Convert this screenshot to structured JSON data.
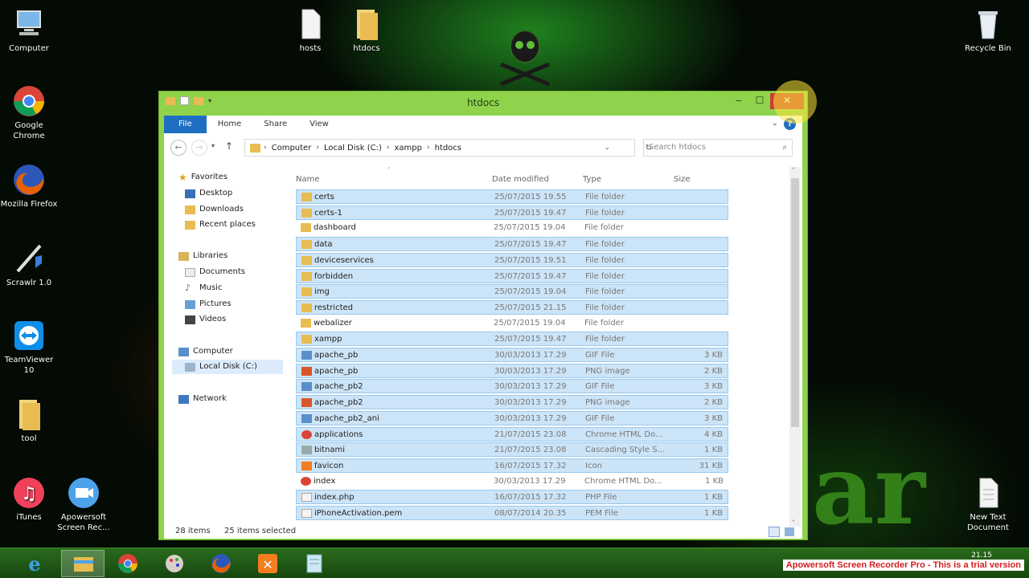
{
  "desktop": {
    "icons": [
      {
        "id": "computer",
        "label": "Computer"
      },
      {
        "id": "hosts",
        "label": "hosts"
      },
      {
        "id": "htdocs",
        "label": "htdocs"
      },
      {
        "id": "recycle",
        "label": "Recycle Bin"
      },
      {
        "id": "chrome",
        "label": "Google Chrome"
      },
      {
        "id": "firefox",
        "label": "Mozilla Firefox"
      },
      {
        "id": "scrawlr",
        "label": "Scrawlr 1.0"
      },
      {
        "id": "teamviewer",
        "label": "TeamViewer 10"
      },
      {
        "id": "tool",
        "label": "tool"
      },
      {
        "id": "itunes",
        "label": "iTunes"
      },
      {
        "id": "apowersoft",
        "label": "Apowersoft Screen Rec..."
      },
      {
        "id": "newtext",
        "label": "New Text Document"
      }
    ],
    "wallpaper_text": "ar"
  },
  "window": {
    "title": "htdocs",
    "minimize": "‒",
    "maximize": "☐",
    "close": "✕",
    "ribbon_tabs": [
      "File",
      "Home",
      "Share",
      "View"
    ],
    "help": "?",
    "address": {
      "crumbs": [
        "Computer",
        "Local Disk (C:)",
        "xampp",
        "htdocs"
      ]
    },
    "search": {
      "placeholder": "Search htdocs"
    },
    "nav": {
      "favorites": "Favorites",
      "desktop": "Desktop",
      "downloads": "Downloads",
      "recent": "Recent places",
      "libraries": "Libraries",
      "documents": "Documents",
      "music": "Music",
      "pictures": "Pictures",
      "videos": "Videos",
      "computer": "Computer",
      "localdisk": "Local Disk (C:)",
      "network": "Network"
    },
    "columns": {
      "name": "Name",
      "date": "Date modified",
      "type": "Type",
      "size": "Size"
    },
    "files": [
      {
        "name": "certs",
        "date": "25/07/2015 19.55",
        "type": "File folder",
        "size": "",
        "icon": "folder",
        "selected": true
      },
      {
        "name": "certs-1",
        "date": "25/07/2015 19.47",
        "type": "File folder",
        "size": "",
        "icon": "folder",
        "selected": true
      },
      {
        "name": "dashboard",
        "date": "25/07/2015 19.04",
        "type": "File folder",
        "size": "",
        "icon": "folder",
        "selected": false
      },
      {
        "name": "data",
        "date": "25/07/2015 19.47",
        "type": "File folder",
        "size": "",
        "icon": "folder",
        "selected": true
      },
      {
        "name": "deviceservices",
        "date": "25/07/2015 19.51",
        "type": "File folder",
        "size": "",
        "icon": "folder",
        "selected": true
      },
      {
        "name": "forbidden",
        "date": "25/07/2015 19.47",
        "type": "File folder",
        "size": "",
        "icon": "folder",
        "selected": true
      },
      {
        "name": "img",
        "date": "25/07/2015 19.04",
        "type": "File folder",
        "size": "",
        "icon": "folder",
        "selected": true
      },
      {
        "name": "restricted",
        "date": "25/07/2015 21.15",
        "type": "File folder",
        "size": "",
        "icon": "folder",
        "selected": true
      },
      {
        "name": "webalizer",
        "date": "25/07/2015 19.04",
        "type": "File folder",
        "size": "",
        "icon": "folder",
        "selected": false
      },
      {
        "name": "xampp",
        "date": "25/07/2015 19.47",
        "type": "File folder",
        "size": "",
        "icon": "folder",
        "selected": true
      },
      {
        "name": "apache_pb",
        "date": "30/03/2013 17.29",
        "type": "GIF File",
        "size": "3 KB",
        "icon": "gif",
        "selected": true
      },
      {
        "name": "apache_pb",
        "date": "30/03/2013 17.29",
        "type": "PNG image",
        "size": "2 KB",
        "icon": "png",
        "selected": true
      },
      {
        "name": "apache_pb2",
        "date": "30/03/2013 17.29",
        "type": "GIF File",
        "size": "3 KB",
        "icon": "gif",
        "selected": true
      },
      {
        "name": "apache_pb2",
        "date": "30/03/2013 17.29",
        "type": "PNG image",
        "size": "2 KB",
        "icon": "png",
        "selected": true
      },
      {
        "name": "apache_pb2_ani",
        "date": "30/03/2013 17.29",
        "type": "GIF File",
        "size": "3 KB",
        "icon": "gif",
        "selected": true
      },
      {
        "name": "applications",
        "date": "21/07/2015 23.08",
        "type": "Chrome HTML Do...",
        "size": "4 KB",
        "icon": "chrome",
        "selected": true
      },
      {
        "name": "bitnami",
        "date": "21/07/2015 23.08",
        "type": "Cascading Style S...",
        "size": "1 KB",
        "icon": "css",
        "selected": true
      },
      {
        "name": "favicon",
        "date": "16/07/2015 17.32",
        "type": "Icon",
        "size": "31 KB",
        "icon": "ico",
        "selected": true
      },
      {
        "name": "index",
        "date": "30/03/2013 17.29",
        "type": "Chrome HTML Do...",
        "size": "1 KB",
        "icon": "chrome",
        "selected": false
      },
      {
        "name": "index.php",
        "date": "16/07/2015 17.32",
        "type": "PHP File",
        "size": "1 KB",
        "icon": "doc",
        "selected": true
      },
      {
        "name": "iPhoneActivation.pem",
        "date": "08/07/2014 20.35",
        "type": "PEM File",
        "size": "1 KB",
        "icon": "doc",
        "selected": true
      }
    ],
    "status": {
      "items": "28 items",
      "selected": "25 items selected"
    }
  },
  "taskbar": {
    "items": [
      "ie",
      "explorer",
      "chrome",
      "paint",
      "firefox",
      "xampp",
      "notepad"
    ],
    "clock": "21.15"
  },
  "watermark": "Apowersoft Screen Recorder Pro - This is a trial version",
  "colors": {
    "window_frame": "#8fd24c",
    "file_tab": "#1e6fc2",
    "selection": "#cce4f7",
    "taskbar": "#1e5a15"
  }
}
